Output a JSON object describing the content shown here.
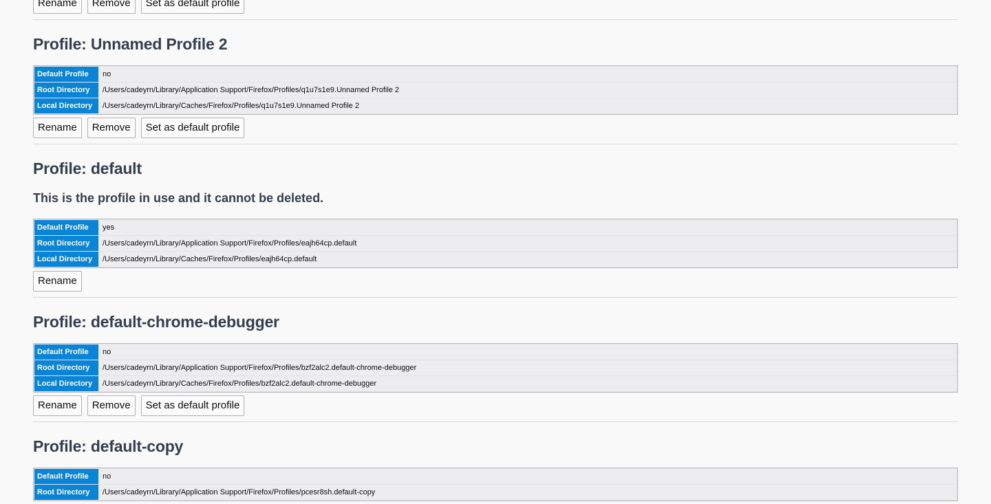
{
  "top_buttons": {
    "rename": "Rename",
    "remove": "Remove",
    "set_default": "Set as default profile"
  },
  "labels": {
    "default_profile": "Default Profile",
    "root_directory": "Root Directory",
    "local_directory": "Local Directory"
  },
  "profiles": [
    {
      "title": "Profile: Unnamed Profile 2",
      "default": "no",
      "root": "/Users/cadeyrn/Library/Application Support/Firefox/Profiles/q1u7s1e9.Unnamed Profile 2",
      "local": "/Users/cadeyrn/Library/Caches/Firefox/Profiles/q1u7s1e9.Unnamed Profile 2",
      "buttons": {
        "rename": "Rename",
        "remove": "Remove",
        "set_default": "Set as default profile"
      }
    },
    {
      "title": "Profile: default",
      "notice": "This is the profile in use and it cannot be deleted.",
      "default": "yes",
      "root": "/Users/cadeyrn/Library/Application Support/Firefox/Profiles/eajh64cp.default",
      "local": "/Users/cadeyrn/Library/Caches/Firefox/Profiles/eajh64cp.default",
      "buttons": {
        "rename": "Rename"
      }
    },
    {
      "title": "Profile: default-chrome-debugger",
      "default": "no",
      "root": "/Users/cadeyrn/Library/Application Support/Firefox/Profiles/bzf2alc2.default-chrome-debugger",
      "local": "/Users/cadeyrn/Library/Caches/Firefox/Profiles/bzf2alc2.default-chrome-debugger",
      "buttons": {
        "rename": "Rename",
        "remove": "Remove",
        "set_default": "Set as default profile"
      }
    },
    {
      "title": "Profile: default-copy",
      "default": "no",
      "root": "/Users/cadeyrn/Library/Application Support/Firefox/Profiles/pcesr8sh.default-copy"
    }
  ]
}
